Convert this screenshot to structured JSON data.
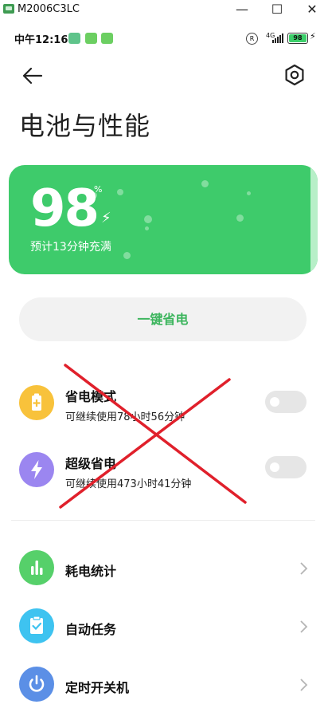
{
  "window": {
    "title": "M2006C3LC",
    "minimize_glyph": "—",
    "maximize_glyph": "☐",
    "close_glyph": "✕"
  },
  "statusbar": {
    "time": "中午12:16",
    "network_label": "4G",
    "registered_glyph": "R",
    "battery_level": "98"
  },
  "header": {
    "title": "电池与性能"
  },
  "battery_card": {
    "percent": "98",
    "percent_sign": "%",
    "charging_glyph": "⚡",
    "estimate": "预计13分钟充满",
    "color": "#3ecb6b"
  },
  "one_key_save": {
    "label": "一键省电"
  },
  "modes": [
    {
      "title": "省电模式",
      "subtitle": "可继续使用78小时56分钟",
      "icon": "battery-saver-icon",
      "color": "#f8c23b",
      "enabled": false
    },
    {
      "title": "超级省电",
      "subtitle": "可继续使用473小时41分钟",
      "icon": "lightning-icon",
      "color": "#9b86f0",
      "enabled": false
    }
  ],
  "menu": [
    {
      "title": "耗电统计",
      "icon": "bar-chart-icon",
      "color": "#56d06a"
    },
    {
      "title": "自动任务",
      "icon": "clipboard-check-icon",
      "color": "#3ec3f0"
    },
    {
      "title": "定时开关机",
      "icon": "power-icon",
      "color": "#5b8fe6"
    }
  ],
  "annotation": {
    "color": "#e0202b"
  }
}
